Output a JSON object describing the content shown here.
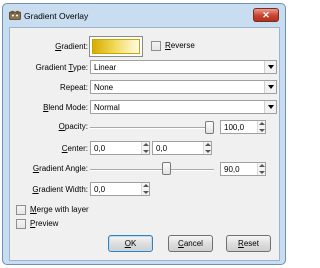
{
  "window": {
    "title": "Gradient Overlay",
    "close_glyph": "✕"
  },
  "labels": {
    "gradient": "Gradient:",
    "reverse": "Reverse",
    "gradient_type": "Gradient Type:",
    "repeat": "Repeat:",
    "blend_mode": "Blend Mode:",
    "opacity": "Opacity:",
    "center": "Center:",
    "gradient_angle": "Gradient Angle:",
    "gradient_width": "Gradient Width:",
    "merge_with_layer": "Merge with layer",
    "preview": "Preview"
  },
  "values": {
    "gradient_type": "Linear",
    "repeat": "None",
    "blend_mode": "Normal",
    "opacity": "100,0",
    "opacity_level": 1.0,
    "center_x": "0,0",
    "center_y": "0,0",
    "gradient_angle": "90,0",
    "gradient_angle_level": 0.625,
    "gradient_width": "0,0",
    "reverse_checked": false,
    "merge_checked": false,
    "preview_checked": false
  },
  "buttons": {
    "ok": "OK",
    "cancel": "Cancel",
    "reset": "Reset"
  },
  "colors": {
    "gradient_start": "#d8ad00",
    "gradient_end": "#fffce8",
    "title_bar": "#c9ddf0",
    "close_button": "#c8432f"
  },
  "icons": {
    "app": "gimp-app-icon",
    "close": "close-icon"
  }
}
